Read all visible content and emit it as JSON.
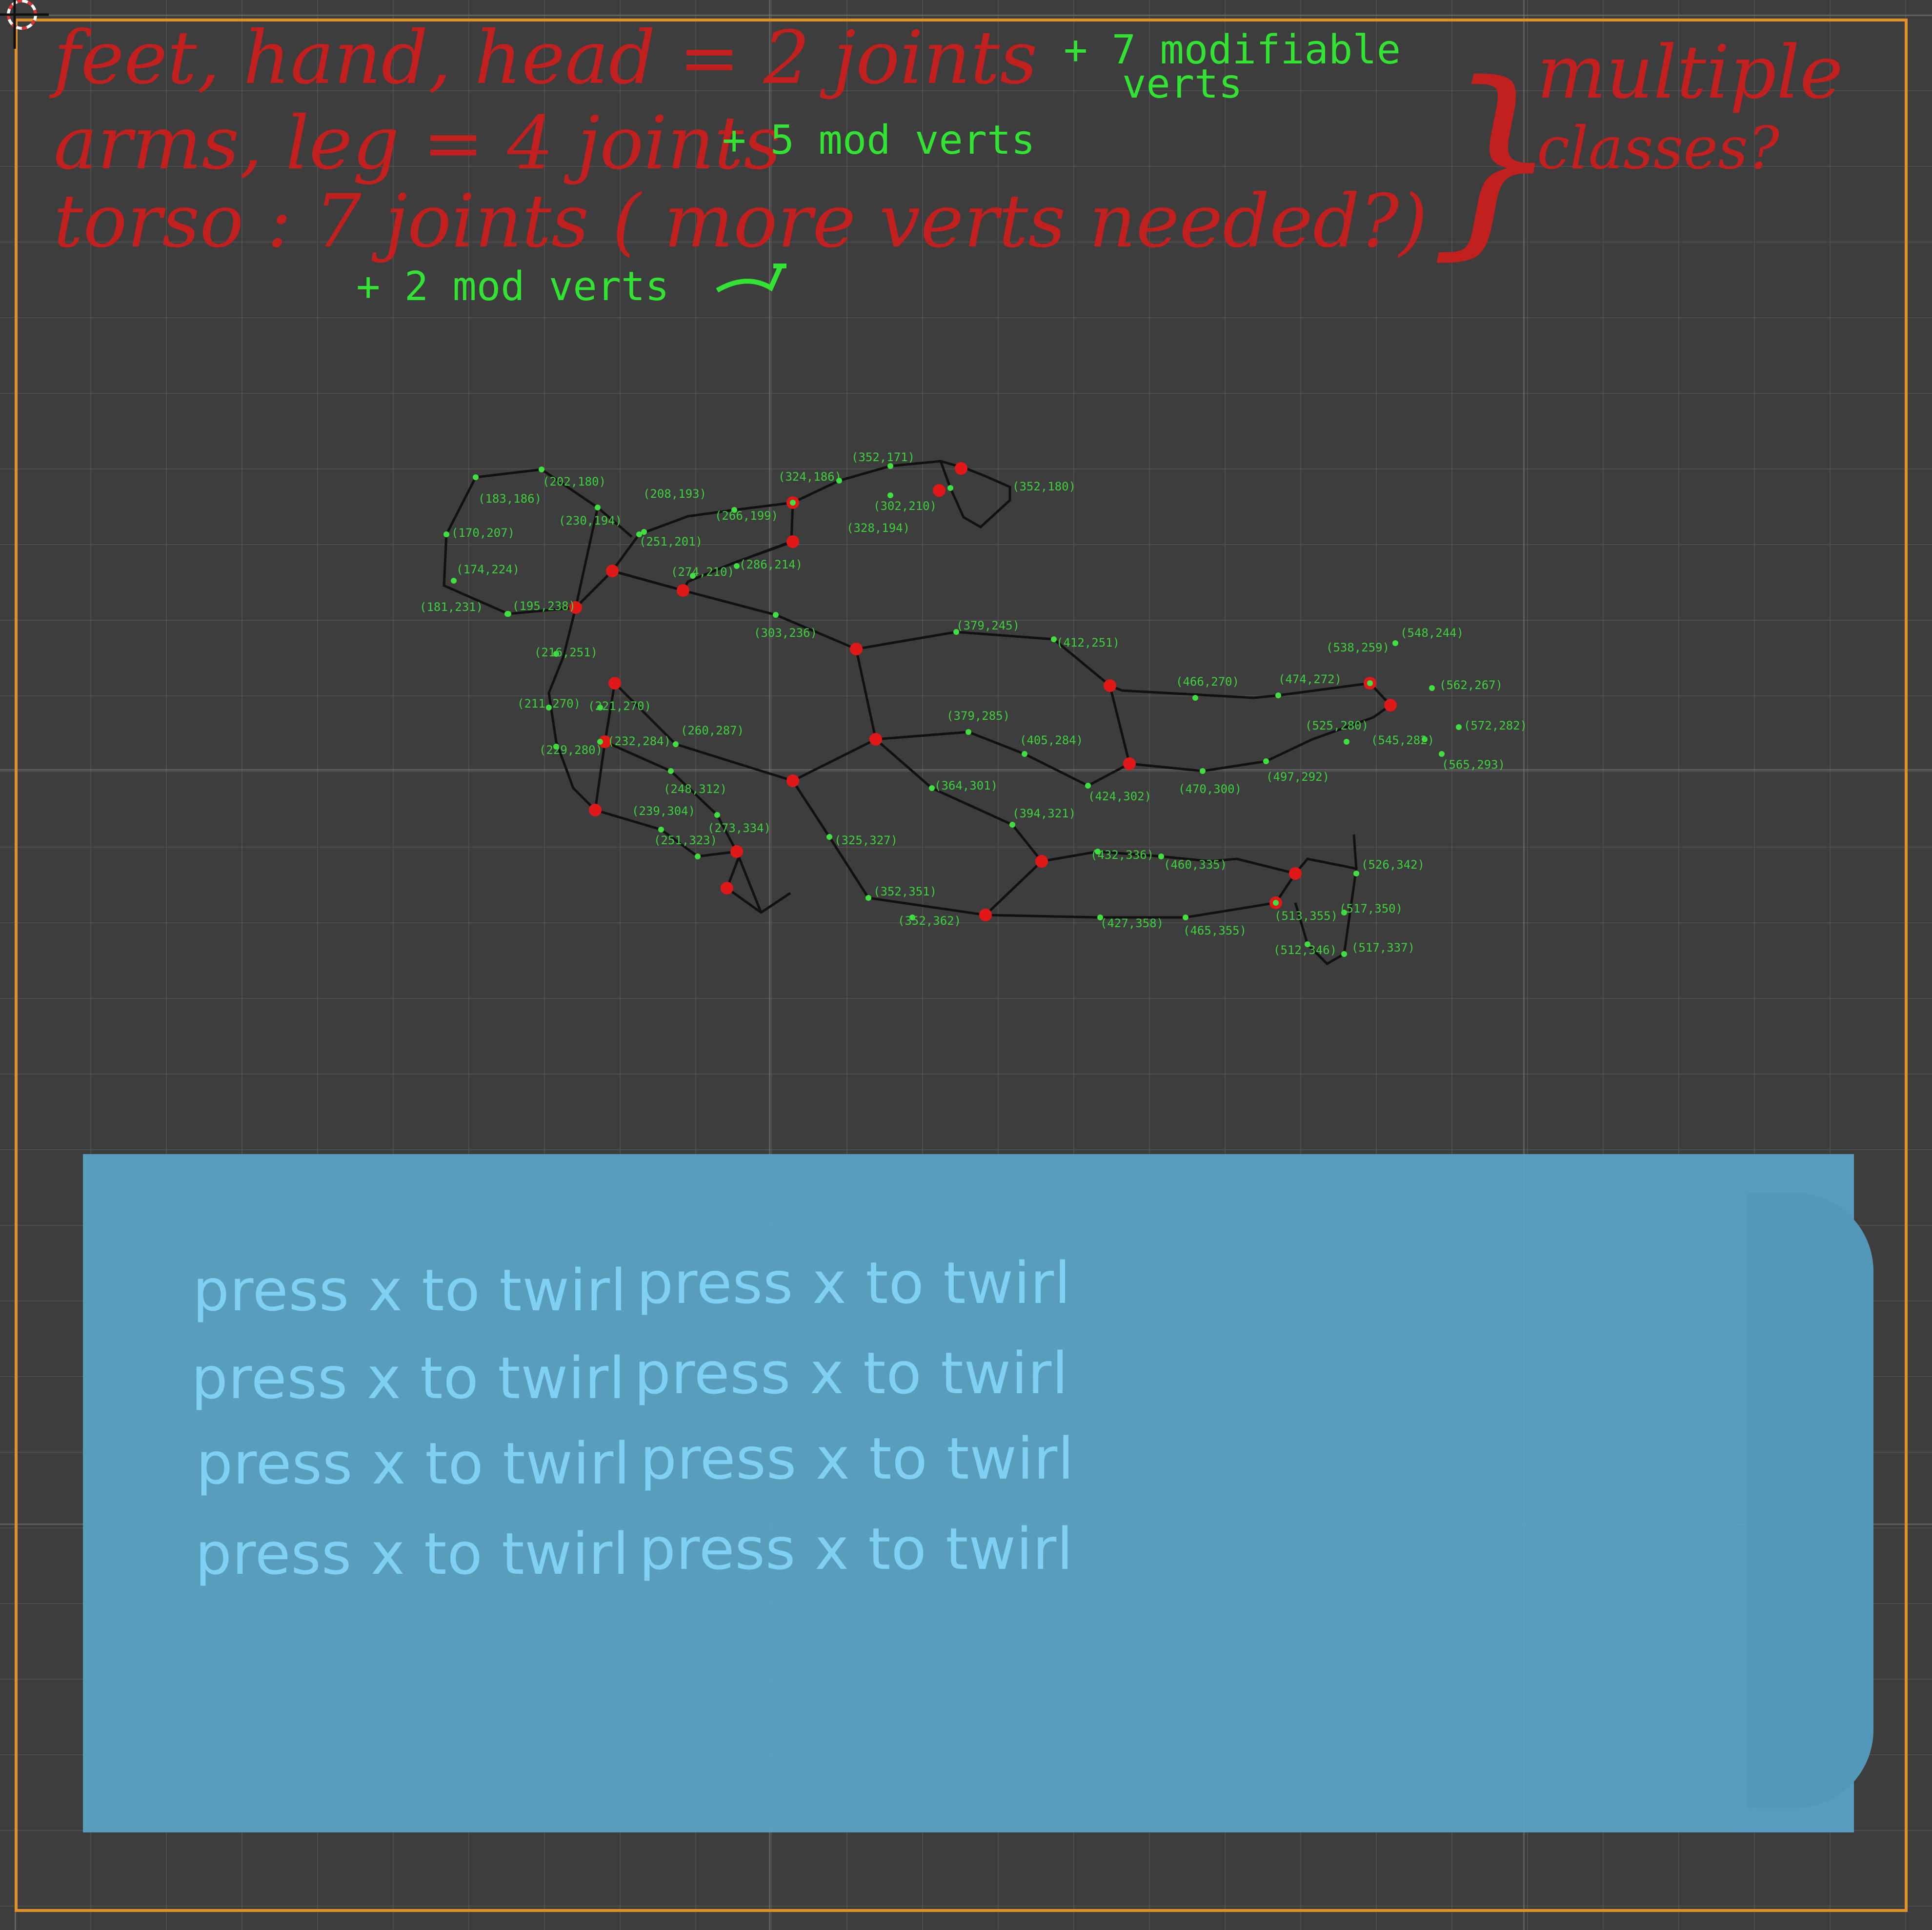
{
  "notes": {
    "red_line1": "feet, hand, head = 2 joints",
    "green_line1a": "+ 7 modifiable",
    "green_line1b": "verts",
    "red_line2": "arms, leg = 4 joints",
    "green_line2": "+ 5 mod verts",
    "red_line3": "torso : 7 joints ( more verts needed?)",
    "green_line3": "+ 2 mod verts",
    "red_brace": "}",
    "red_side1": "multiple",
    "red_side2": "classes?"
  },
  "coords": [
    "(202,180)",
    "(183,186)",
    "(170,207)",
    "(174,224)",
    "(181,231)",
    "(195,238)",
    "(230,194)",
    "(208,193)",
    "(251,201)",
    "(266,199)",
    "(324,186)",
    "(352,171)",
    "(302,210)",
    "(328,194)",
    "(352,180)",
    "(274,210)",
    "(286,214)",
    "(303,236)",
    "(379,245)",
    "(412,251)",
    "(466,270)",
    "(474,272)",
    "(538,259)",
    "(548,244)",
    "(562,267)",
    "(572,282)",
    "(525,280)",
    "(545,282)",
    "(565,293)",
    "(216,251)",
    "(211,270)",
    "(221,270)",
    "(229,280)",
    "(232,284)",
    "(260,287)",
    "(379,285)",
    "(405,284)",
    "(424,302)",
    "(470,300)",
    "(497,292)",
    "(364,301)",
    "(394,321)",
    "(432,336)",
    "(460,335)",
    "(239,304)",
    "(248,312)",
    "(251,323)",
    "(273,334)",
    "(325,327)",
    "(352,351)",
    "(352,362)",
    "(427,358)",
    "(465,355)",
    "(513,355)",
    "(526,342)",
    "(517,350)",
    "(512,346)",
    "(517,337)"
  ],
  "twirl": {
    "line": "press x to twirl"
  }
}
